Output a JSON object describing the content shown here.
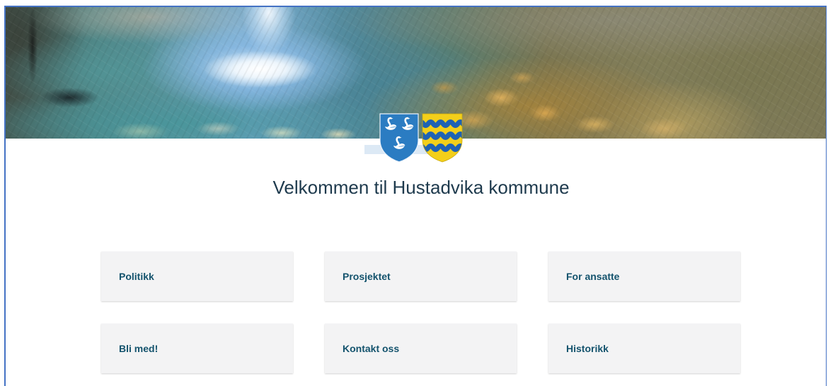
{
  "header": {
    "logo_icons": [
      "coat-of-arms-swans-icon",
      "coat-of-arms-waves-icon"
    ]
  },
  "main": {
    "title": "Velkommen til Hustadvika kommune",
    "cards": [
      {
        "label": "Politikk"
      },
      {
        "label": "Prosjektet"
      },
      {
        "label": "For ansatte"
      },
      {
        "label": "Bli med!"
      },
      {
        "label": "Kontakt oss"
      },
      {
        "label": "Historikk"
      }
    ]
  },
  "colors": {
    "title": "#1e3a4d",
    "card_text": "#14536d",
    "card_background": "#f3f3f4",
    "frame_border": "#4472c4",
    "shield_blue": "#2b7cc2",
    "shield_yellow": "#f3cf1a",
    "shield_wave": "#1f62b3"
  }
}
